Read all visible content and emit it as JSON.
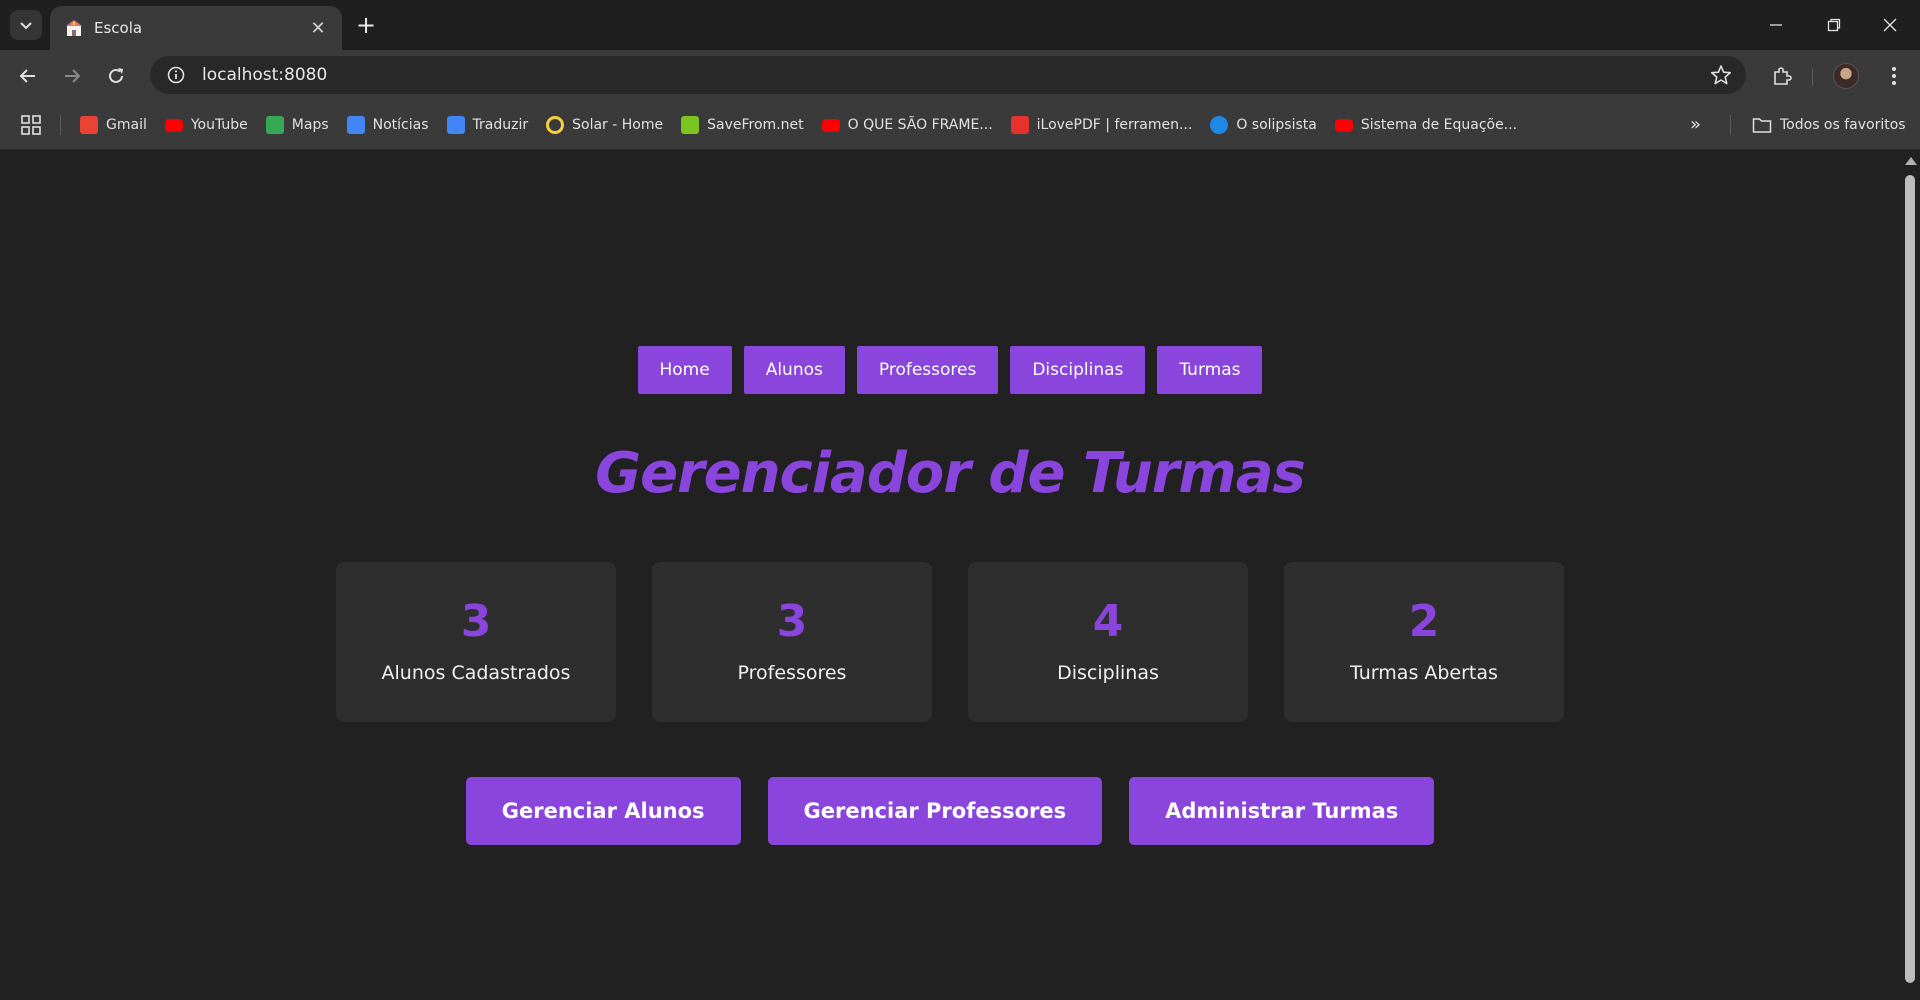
{
  "browser": {
    "tab": {
      "title": "Escola",
      "close": "✕"
    },
    "new_tab": "+",
    "window_controls": {
      "minimize": "─",
      "restore": "❐",
      "close": "✕"
    },
    "url": "localhost:8080",
    "bookmarks": [
      {
        "label": "Gmail",
        "icon": "gmail-icon",
        "color": "#ea4335"
      },
      {
        "label": "YouTube",
        "icon": "youtube-icon",
        "color": "#ff0000"
      },
      {
        "label": "Maps",
        "icon": "maps-icon",
        "color": "#34a853"
      },
      {
        "label": "Notícias",
        "icon": "news-icon",
        "color": "#4285f4"
      },
      {
        "label": "Traduzir",
        "icon": "translate-icon",
        "color": "#4285f4"
      },
      {
        "label": "Solar - Home",
        "icon": "solar-icon",
        "color": "#f4d03f"
      },
      {
        "label": "SaveFrom.net",
        "icon": "download-icon",
        "color": "#7cc41f"
      },
      {
        "label": "O QUE SÃO FRAME...",
        "icon": "youtube-icon",
        "color": "#ff0000"
      },
      {
        "label": "iLovePDF | ferramen...",
        "icon": "heart-icon",
        "color": "#e5322d"
      },
      {
        "label": "O solipsista",
        "icon": "c-icon",
        "color": "#1e88e5"
      },
      {
        "label": "Sistema de Equaçõe...",
        "icon": "youtube-icon",
        "color": "#ff0000"
      }
    ],
    "more_bookmarks": "»",
    "all_bookmarks": "Todos os favoritos"
  },
  "page": {
    "nav": [
      "Home",
      "Alunos",
      "Professores",
      "Disciplinas",
      "Turmas"
    ],
    "title": "Gerenciador de Turmas",
    "stats": [
      {
        "value": "3",
        "label": "Alunos Cadastrados"
      },
      {
        "value": "3",
        "label": "Professores"
      },
      {
        "value": "4",
        "label": "Disciplinas"
      },
      {
        "value": "2",
        "label": "Turmas Abertas"
      }
    ],
    "actions": [
      "Gerenciar Alunos",
      "Gerenciar Professores",
      "Administrar Turmas"
    ],
    "accent_color": "#8a45dd",
    "background_color": "#212121",
    "card_color": "#2e2e2e"
  }
}
